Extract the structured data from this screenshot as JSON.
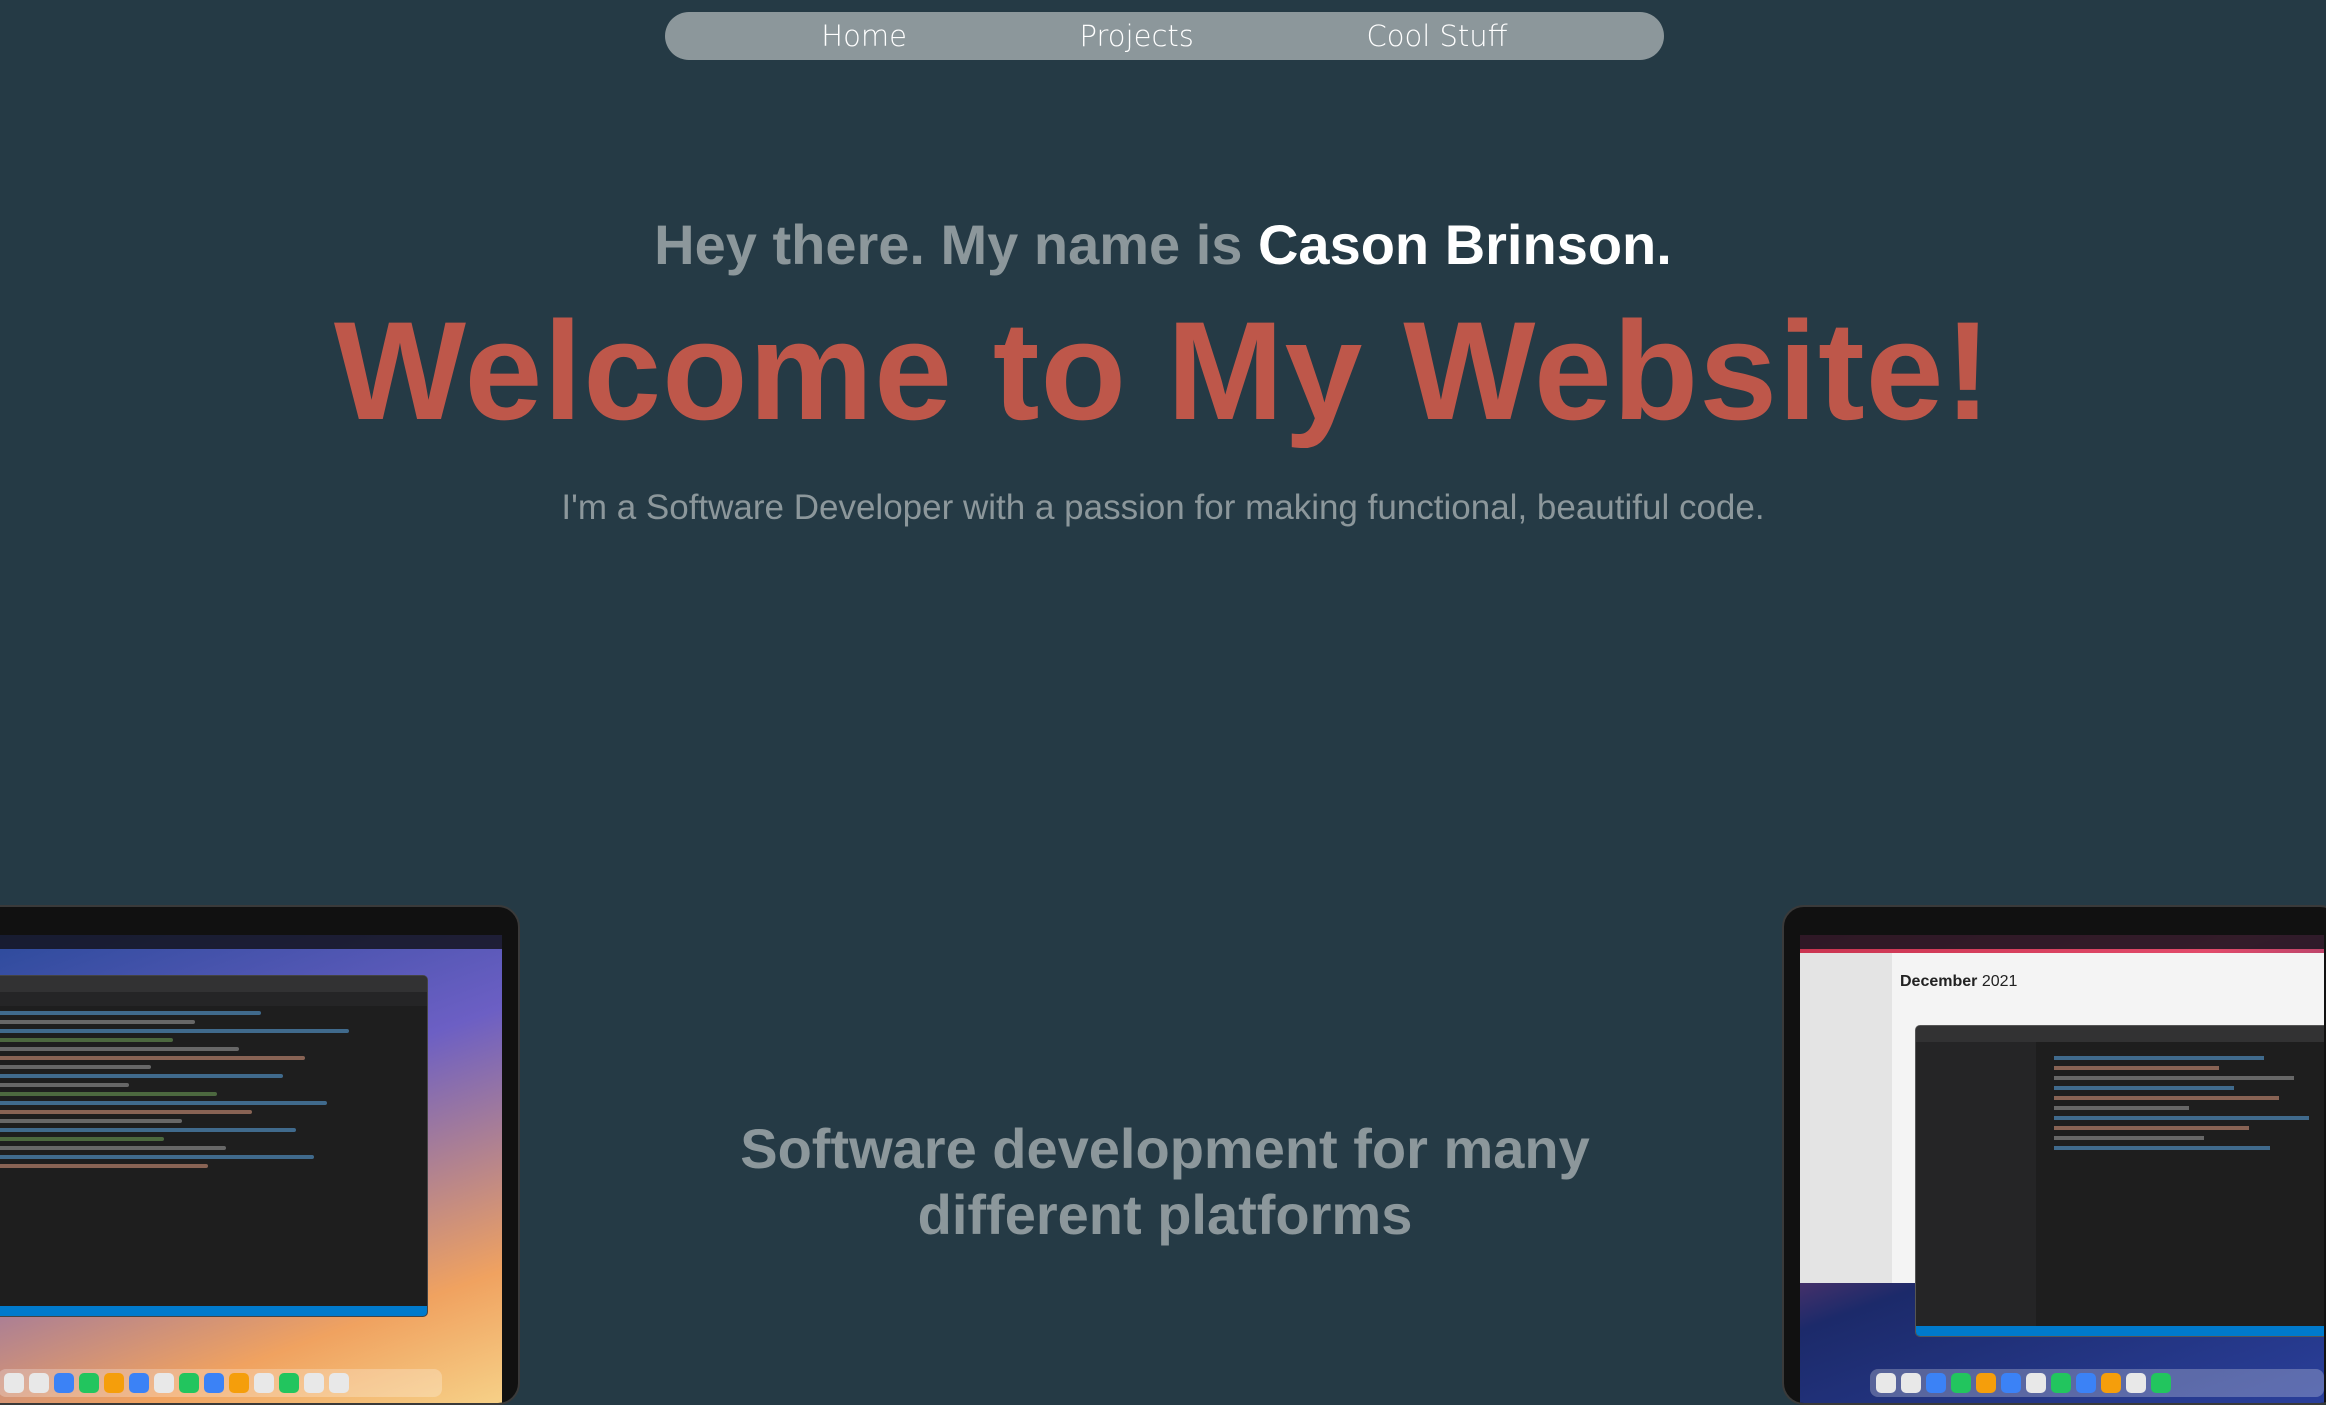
{
  "nav": {
    "items": [
      {
        "label": "Home"
      },
      {
        "label": "Projects"
      },
      {
        "label": "Cool Stuff"
      }
    ]
  },
  "hero": {
    "greeting_prefix": "Hey there. My name is ",
    "greeting_name": "Cason Brinson.",
    "headline": "Welcome to My Website!",
    "tagline": "I'm a Software Developer with a passion for making functional, beautiful code."
  },
  "section": {
    "title_line1": "Software development for many",
    "title_line2": "different platforms"
  },
  "laptop_right": {
    "calendar_month": "December",
    "calendar_year": "2021"
  },
  "colors": {
    "background": "#253a45",
    "nav_bg": "#8c979b",
    "accent": "#be574a",
    "muted_text": "#8c979b",
    "highlight_text": "#ffffff"
  }
}
